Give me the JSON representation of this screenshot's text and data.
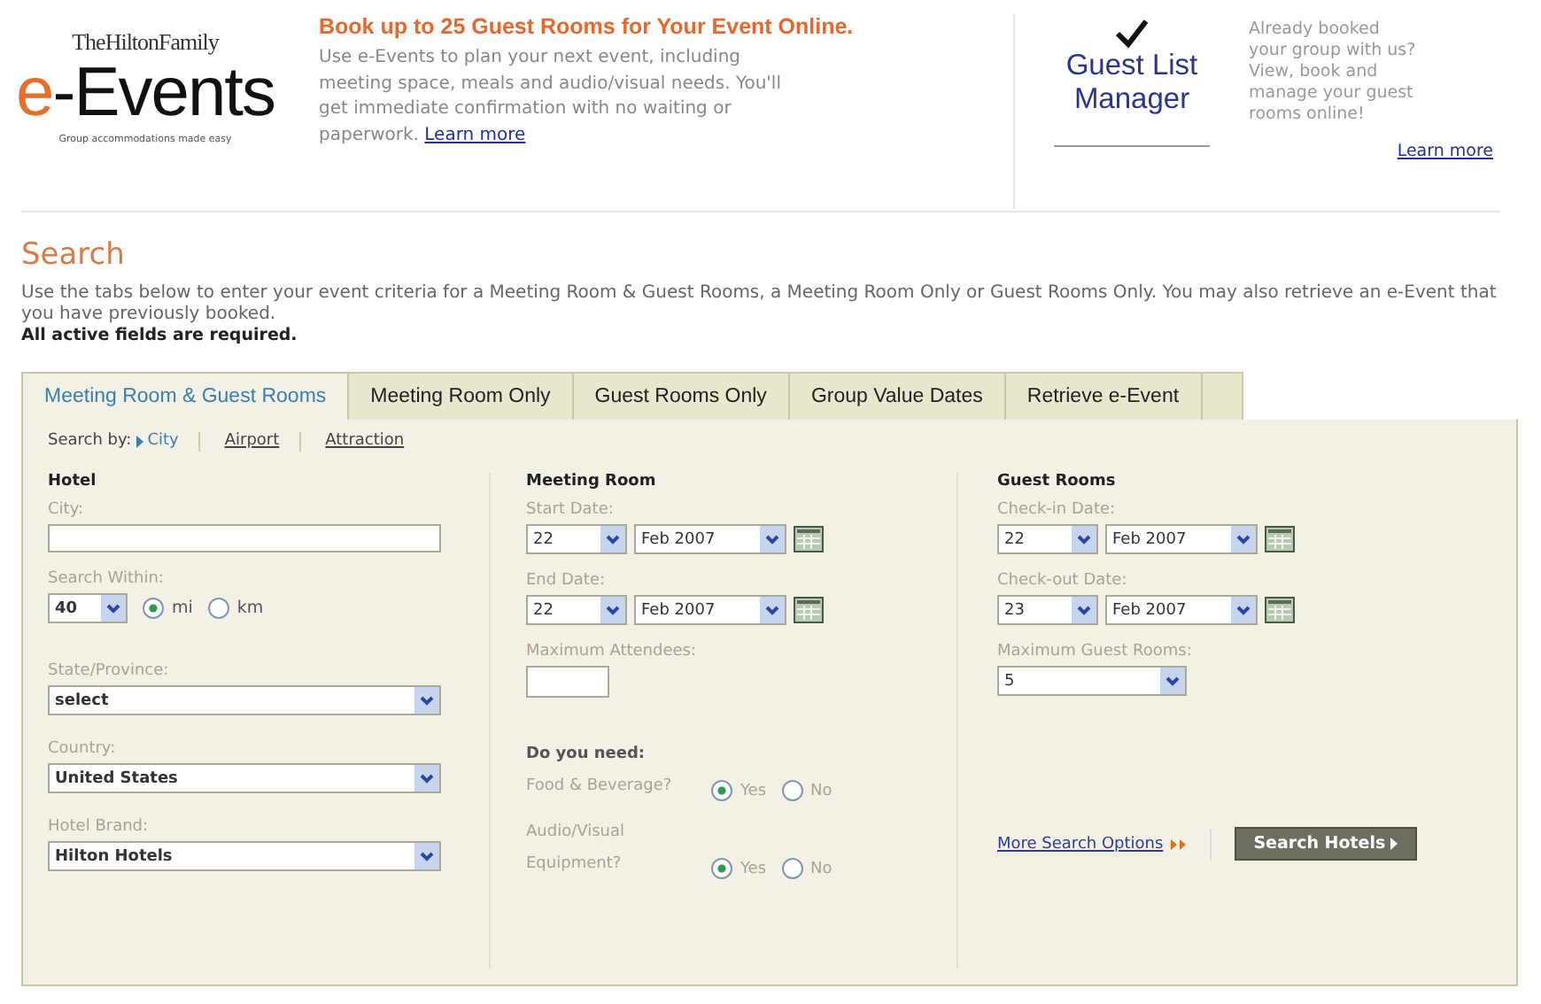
{
  "header": {
    "logo": {
      "family": "TheHiltonFamily",
      "brand": "e-Events",
      "tagline": "Group accommodations made easy"
    },
    "promo": {
      "title": "Book up to 25 Guest Rooms for Your Event Online.",
      "text": "Use e-Events to plan your next event, including meeting space, meals and audio/visual needs. You'll get immediate confirmation with no waiting or paperwork.",
      "link": "Learn more"
    },
    "guest_list": {
      "title": "Guest List Manager",
      "text": "Already booked your group with us? View, book and manage your guest rooms online!",
      "link": "Learn more"
    }
  },
  "search": {
    "title": "Search",
    "intro": "Use the tabs below to enter your event criteria for a Meeting Room & Guest Rooms, a Meeting Room Only or Guest Rooms Only. You may also retrieve an e-Event that you have previously booked.",
    "required": "All active fields are required."
  },
  "tabs": [
    {
      "label": "Meeting Room & Guest Rooms",
      "selected": true
    },
    {
      "label": "Meeting Room Only",
      "selected": false
    },
    {
      "label": "Guest Rooms Only",
      "selected": false
    },
    {
      "label": "Group Value Dates",
      "selected": false
    },
    {
      "label": "Retrieve e-Event",
      "selected": false
    }
  ],
  "search_by": {
    "label": "Search by:",
    "options": [
      {
        "label": "City",
        "selected": true
      },
      {
        "label": "Airport",
        "selected": false
      },
      {
        "label": "Attraction",
        "selected": false
      }
    ]
  },
  "columns": [
    {
      "heading": "Hotel",
      "fields": [
        {
          "kind": "text",
          "label": "City:"
        },
        {
          "kind": "distance",
          "label": "Search Within:",
          "value": "40",
          "options": [
            {
              "label": "mi",
              "selected": true
            },
            {
              "label": "km",
              "selected": false
            }
          ]
        },
        {
          "kind": "select",
          "label": "State/Province:",
          "value": "select"
        },
        {
          "kind": "select",
          "label": "Country:",
          "value": "United States"
        },
        {
          "kind": "select",
          "label": "Hotel Brand:",
          "value": "Hilton Hotels"
        }
      ]
    },
    {
      "heading": "Meeting Room",
      "fields": [
        {
          "kind": "date",
          "label": "Start Date:",
          "day": "22",
          "month": "Feb 2007"
        },
        {
          "kind": "date",
          "label": "End Date:",
          "day": "22",
          "month": "Feb 2007"
        },
        {
          "kind": "short-text",
          "label": "Maximum Attendees:"
        },
        {
          "kind": "subheading",
          "label": "Do you need:"
        },
        {
          "kind": "radio",
          "label": "Food & Beverage?",
          "options": [
            {
              "label": "Yes",
              "selected": true
            },
            {
              "label": "No",
              "selected": false
            }
          ]
        },
        {
          "kind": "radio",
          "label": "Audio/Visual Equipment?",
          "options": [
            {
              "label": "Yes",
              "selected": true
            },
            {
              "label": "No",
              "selected": false
            }
          ]
        }
      ]
    },
    {
      "heading": "Guest Rooms",
      "fields": [
        {
          "kind": "date",
          "label": "Check-in Date:",
          "day": "22",
          "month": "Feb 2007"
        },
        {
          "kind": "date",
          "label": "Check-out Date:",
          "day": "23",
          "month": "Feb 2007"
        },
        {
          "kind": "short-select",
          "label": "Maximum Guest Rooms:",
          "value": "5"
        }
      ]
    }
  ],
  "actions": {
    "link": "More Search Options",
    "button": "Search Hotels"
  }
}
